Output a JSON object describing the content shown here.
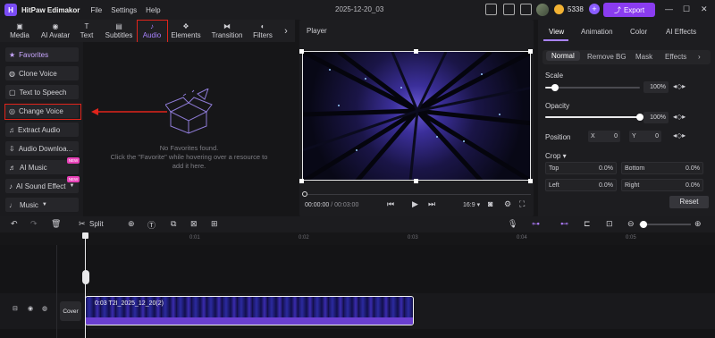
{
  "app": {
    "name": "HitPaw Edimakor",
    "logo_letter": "H",
    "project_name": "2025-12-20_03"
  },
  "menu": [
    "File",
    "Settings",
    "Help"
  ],
  "account": {
    "credits": "5338",
    "export_label": "Export"
  },
  "window_controls": [
    "—",
    "☐",
    "✕"
  ],
  "media_tabs": [
    {
      "label": "Media",
      "icon": "media-icon"
    },
    {
      "label": "AI Avatar",
      "icon": "avatar-icon"
    },
    {
      "label": "Text",
      "icon": "text-icon"
    },
    {
      "label": "Subtitles",
      "icon": "subtitles-icon"
    },
    {
      "label": "Audio",
      "icon": "music-note-icon"
    },
    {
      "label": "Elements",
      "icon": "elements-icon"
    },
    {
      "label": "Transition",
      "icon": "transition-icon"
    },
    {
      "label": "Filters",
      "icon": "filters-icon"
    }
  ],
  "active_tab": "Audio",
  "sidebar": {
    "items": [
      {
        "label": "Favorites"
      },
      {
        "label": "Clone Voice"
      },
      {
        "label": "Text to Speech"
      },
      {
        "label": "Change Voice"
      },
      {
        "label": "Extract Audio"
      },
      {
        "label": "Audio Downloa..."
      },
      {
        "label": "AI Music",
        "badge": "NEW"
      },
      {
        "label": "AI Sound Effect",
        "badge": "NEW"
      },
      {
        "label": "Music"
      }
    ]
  },
  "empty_state": {
    "title": "No Favorites found.",
    "hint_line1": "Click the \"Favorite\" while hovering over a resource to",
    "hint_line2": "add it here."
  },
  "player": {
    "title": "Player",
    "current_time": "00:00:00",
    "separator": " / ",
    "total_time": "00:03:00",
    "aspect": "16:9"
  },
  "properties": {
    "tabs": [
      "View",
      "Animation",
      "Color",
      "AI Effects"
    ],
    "active_tab": "View",
    "subtabs": [
      "Normal",
      "Remove BG",
      "Mask",
      "Effects"
    ],
    "active_subtab": "Normal",
    "scale": {
      "label": "Scale",
      "value": "100%",
      "level": 0.1
    },
    "opacity": {
      "label": "Opacity",
      "value": "100%",
      "level": 1.0
    },
    "position": {
      "label": "Position",
      "x_label": "X",
      "x_value": "0",
      "y_label": "Y",
      "y_value": "0"
    },
    "crop": {
      "label": "Crop",
      "top_label": "Top",
      "top_value": "0.0%",
      "bottom_label": "Bottom",
      "bottom_value": "0.0%",
      "left_label": "Left",
      "left_value": "0.0%",
      "right_label": "Right",
      "right_value": "0.0%"
    },
    "reset_label": "Reset"
  },
  "timeline_toolbar": {
    "split_label": "Split"
  },
  "ruler": {
    "ticks": [
      "0",
      "0:01",
      "0:02",
      "0:03",
      "0:04",
      "0:05"
    ]
  },
  "clip": {
    "label": "0:03  T2I_2025_12_20(2)"
  },
  "cover_label": "Cover",
  "colors": {
    "accent": "#8a3cf0",
    "highlight": "#e0241b",
    "active_tab": "#a983ff"
  }
}
